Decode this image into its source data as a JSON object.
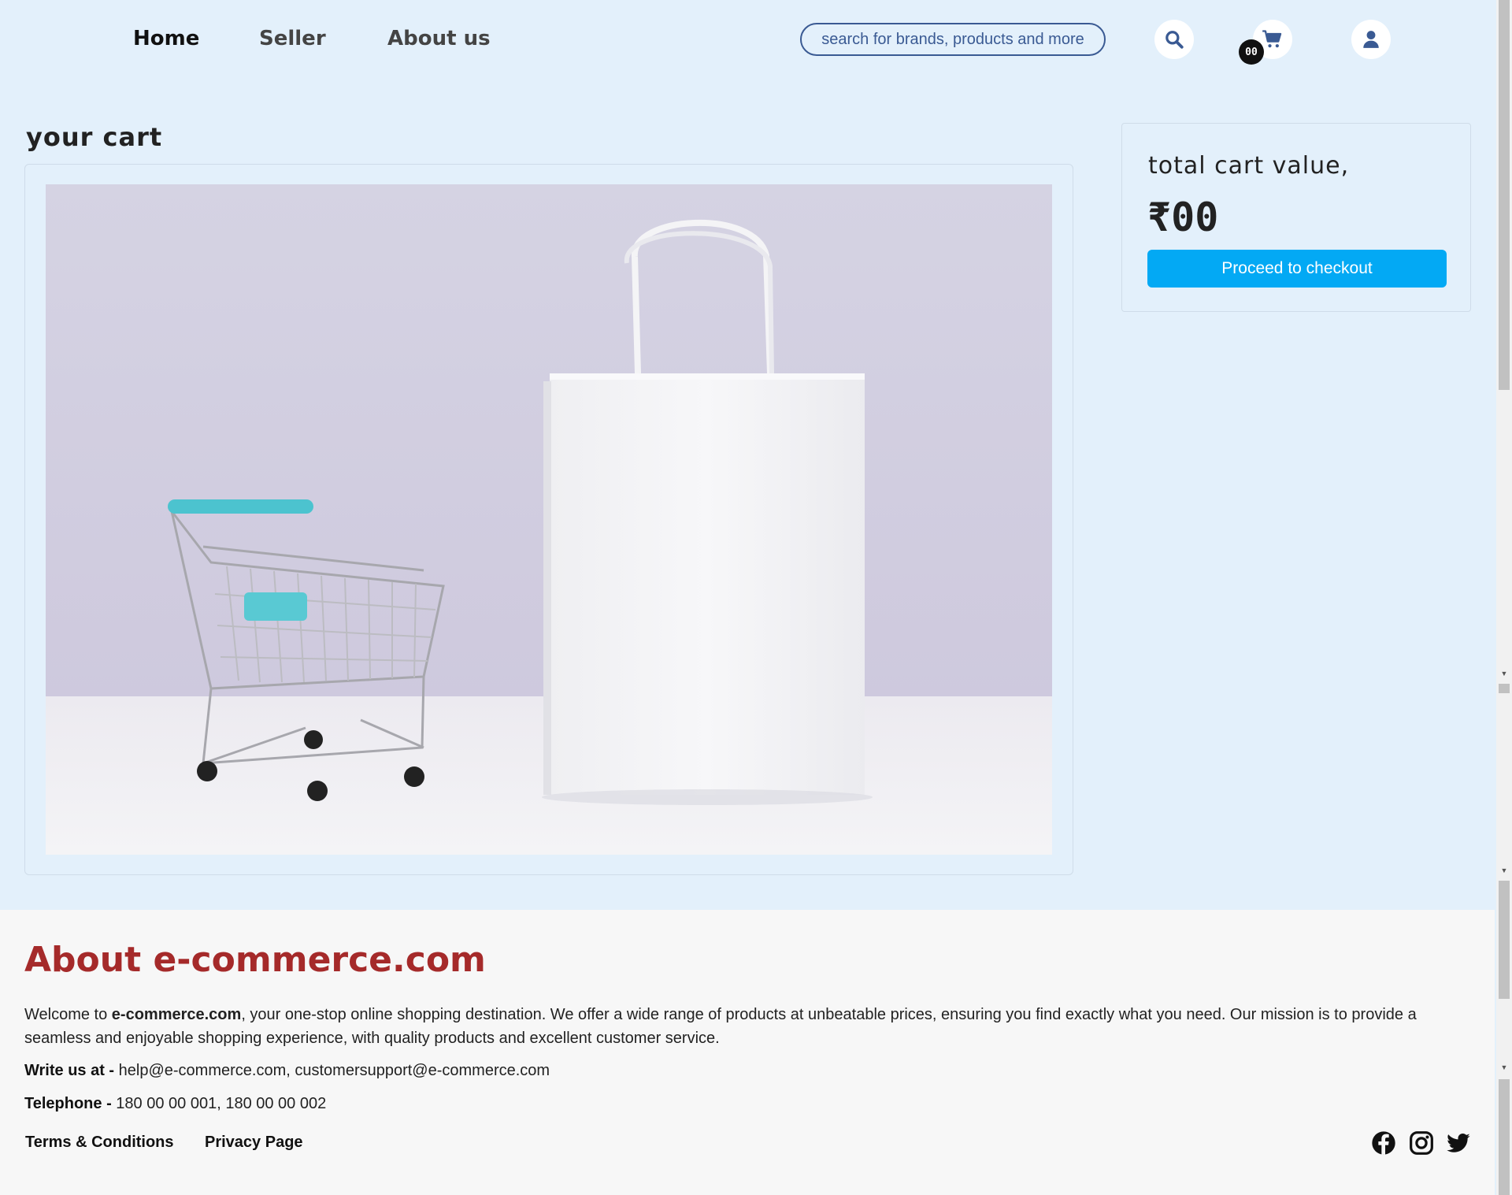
{
  "nav": {
    "home": "Home",
    "seller": "Seller",
    "about": "About us"
  },
  "search": {
    "placeholder": "search for brands, products and more"
  },
  "header_icons": {
    "search": "search-icon",
    "cart": "cart-icon",
    "account": "user-icon"
  },
  "cart_badge": "00",
  "cart": {
    "title": "your cart",
    "image": "shopping-cart-and-white-bag"
  },
  "summary": {
    "label": "total cart value,",
    "value": "₹00",
    "checkout_label": "Proceed to checkout"
  },
  "footer": {
    "title": "About e-commerce.com",
    "welcome_prefix": "Welcome to ",
    "brand": "e-commerce.com",
    "welcome_rest": ", your one-stop online shopping destination. We offer a wide range of products at unbeatable prices, ensuring you find exactly what you need. Our mission is to provide a seamless and enjoyable shopping experience, with quality products and excellent customer service.",
    "write_label": "Write us at -",
    "write_value": " help@e-commerce.com, customersupport@e-commerce.com",
    "tel_label": "Telephone -",
    "tel_value": " 180 00 00 001, 180 00 00 002",
    "terms": "Terms & Conditions",
    "privacy": "Privacy Page",
    "social": [
      "facebook-icon",
      "instagram-icon",
      "twitter-icon"
    ]
  },
  "colors": {
    "page_bg": "#e3f0fb",
    "accent": "#03a9f4",
    "footer_title": "#a52a2a",
    "nav_icon": "#3a5a93"
  }
}
